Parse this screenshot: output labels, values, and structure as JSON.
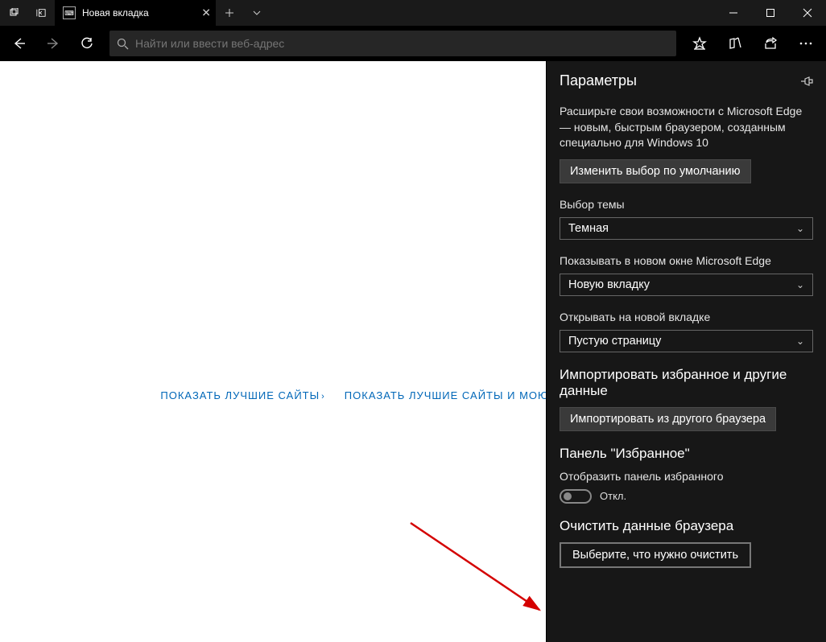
{
  "syschrome": {
    "tab_title": "Новая вкладка"
  },
  "toolbar": {
    "search_placeholder": "Найти или ввести веб-адрес"
  },
  "content": {
    "link_topsites": "ПОКАЗАТЬ ЛУЧШИЕ САЙТЫ",
    "link_topsites_news": "ПОКАЗАТЬ ЛУЧШИЕ САЙТЫ И МОЮ ЛЕНТУ НОВОСТЕЙ"
  },
  "panel": {
    "title": "Параметры",
    "promo_desc": "Расширьте свои возможности с Microsoft Edge — новым, быстрым браузером, созданным специально для Windows 10",
    "promo_button": "Изменить выбор по умолчанию",
    "theme_label": "Выбор темы",
    "theme_value": "Темная",
    "openwith_label": "Показывать в новом окне Microsoft Edge",
    "openwith_value": "Новую вкладку",
    "newtab_label": "Открывать на новой вкладке",
    "newtab_value": "Пустую страницу",
    "import_heading": "Импортировать избранное и другие данные",
    "import_button": "Импортировать из другого браузера",
    "favbar_heading": "Панель \"Избранное\"",
    "favbar_label": "Отобразить панель избранного",
    "favbar_state": "Откл.",
    "clear_heading": "Очистить данные браузера",
    "clear_button": "Выберите, что нужно очистить"
  }
}
